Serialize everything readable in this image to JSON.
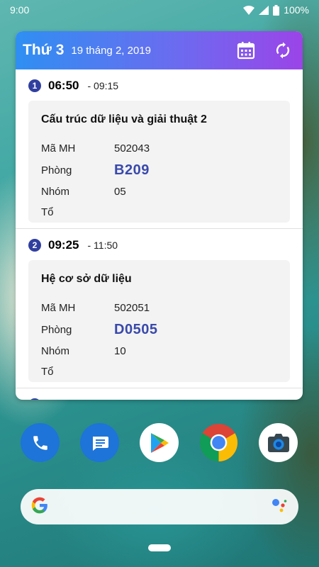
{
  "status_bar": {
    "time": "9:00",
    "battery": "100%"
  },
  "widget": {
    "day": "Thứ 3",
    "date": "19 tháng 2, 2019",
    "sessions": [
      {
        "index": "1",
        "start": "06:50",
        "end": "- 09:15",
        "course": "Cấu trúc dữ liệu và giải thuật 2",
        "code_label": "Mã MH",
        "code": "502043",
        "room_label": "Phòng",
        "room": "B209",
        "group_label": "Nhóm",
        "group": "05",
        "team_label": "Tổ",
        "team": ""
      },
      {
        "index": "2",
        "start": "09:25",
        "end": "- 11:50",
        "course": "Hệ cơ sở dữ liệu",
        "code_label": "Mã MH",
        "code": "502051",
        "room_label": "Phòng",
        "room": "D0505",
        "group_label": "Nhóm",
        "group": "10",
        "team_label": "Tổ",
        "team": ""
      }
    ]
  },
  "dock": {
    "apps": [
      "phone-icon",
      "messages-icon",
      "play-store-icon",
      "chrome-icon",
      "camera-icon"
    ]
  },
  "colors": {
    "header_start": "#2f8ff2",
    "header_end": "#9b44e8",
    "room_text": "#3949ab",
    "badge": "#303f9f"
  }
}
